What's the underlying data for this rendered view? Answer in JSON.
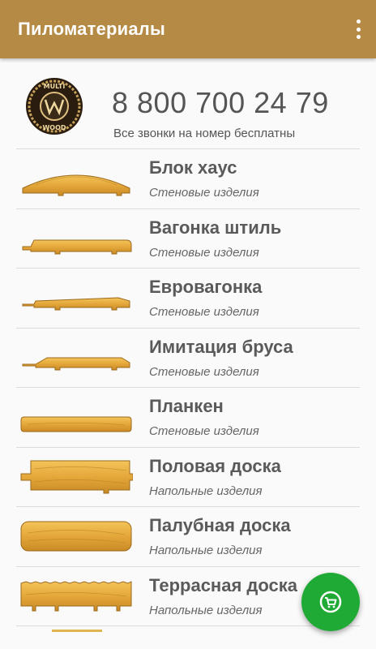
{
  "appbar": {
    "title": "Пиломатериалы",
    "overflow_icon": "more-vert-icon"
  },
  "header": {
    "logo_icon": "multi-wood-logo-icon",
    "logo_text_top": "MULTI",
    "logo_text_bottom": "WOOD",
    "phone": "8 800 700 24 79",
    "note": "Все звонки на номер бесплатны"
  },
  "items": [
    {
      "title": "Блок хаус",
      "subtitle": "Стеновые изделия",
      "icon": "block-house-profile-icon"
    },
    {
      "title": "Вагонка штиль",
      "subtitle": "Стеновые изделия",
      "icon": "shtil-lining-profile-icon"
    },
    {
      "title": "Евровагонка",
      "subtitle": "Стеновые изделия",
      "icon": "euro-lining-profile-icon"
    },
    {
      "title": "Имитация бруса",
      "subtitle": "Стеновые изделия",
      "icon": "timber-imitation-profile-icon"
    },
    {
      "title": "Планкен",
      "subtitle": "Стеновые изделия",
      "icon": "planken-profile-icon"
    },
    {
      "title": "Половая доска",
      "subtitle": "Напольные изделия",
      "icon": "floor-board-profile-icon"
    },
    {
      "title": "Палубная доска",
      "subtitle": "Напольные изделия",
      "icon": "deck-board-profile-icon"
    },
    {
      "title": "Террасная доска",
      "subtitle": "Напольные изделия",
      "icon": "terrace-board-profile-icon"
    }
  ],
  "fab": {
    "icon": "shopping-cart-icon"
  },
  "colors": {
    "appbar": "#b48a45",
    "fab": "#1fa935",
    "wood": "#e3a73a",
    "text": "#5a5a5a"
  }
}
